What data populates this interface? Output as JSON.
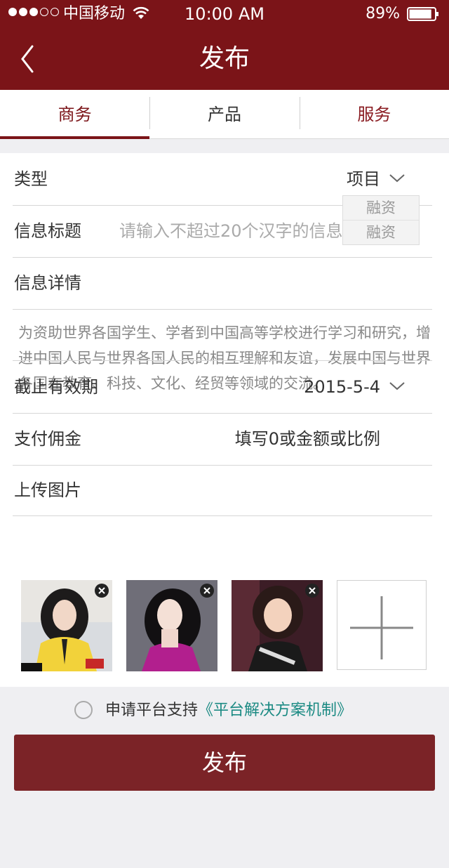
{
  "status_bar": {
    "carrier": "中国移动",
    "time": "10:00 AM",
    "battery": "89%",
    "battery_level": 0.89,
    "signal_strength": 3
  },
  "nav": {
    "title": "发布",
    "back_icon": "chevron-left-icon"
  },
  "tabs": [
    {
      "label": "商务",
      "active": true
    },
    {
      "label": "产品",
      "active": false
    },
    {
      "label": "服务",
      "active": false
    }
  ],
  "form": {
    "type": {
      "label": "类型",
      "value": "项目",
      "options": [
        "融资",
        "融资"
      ]
    },
    "title": {
      "label": "信息标题",
      "placeholder": "请输入不超过20个汉字的信息"
    },
    "details": {
      "label": "信息详情",
      "text": "为资助世界各国学生、学者到中国高等学校进行学习和研究，增进中国人民与世界各国人民的相互理解和友谊，发展中国与世界各国在教育、科技、文化、经贸等领域的交流。"
    },
    "deadline": {
      "label": "截止有效期",
      "value": "2015-5-4"
    },
    "commission": {
      "label": "支付佣金",
      "placeholder": "填写0或金额或比例"
    },
    "upload": {
      "label": "上传图片",
      "add_icon": "plus-icon",
      "remove_icon": "close-icon",
      "photo_count": 3
    }
  },
  "agreement": {
    "text": "申请平台支持",
    "link": "《平台解决方案机制》",
    "checked": false
  },
  "publish_button": "发布",
  "colors": {
    "brand": "#7b1418",
    "button": "#7b2327",
    "link": "#1b8a83",
    "background": "#efeff2"
  }
}
